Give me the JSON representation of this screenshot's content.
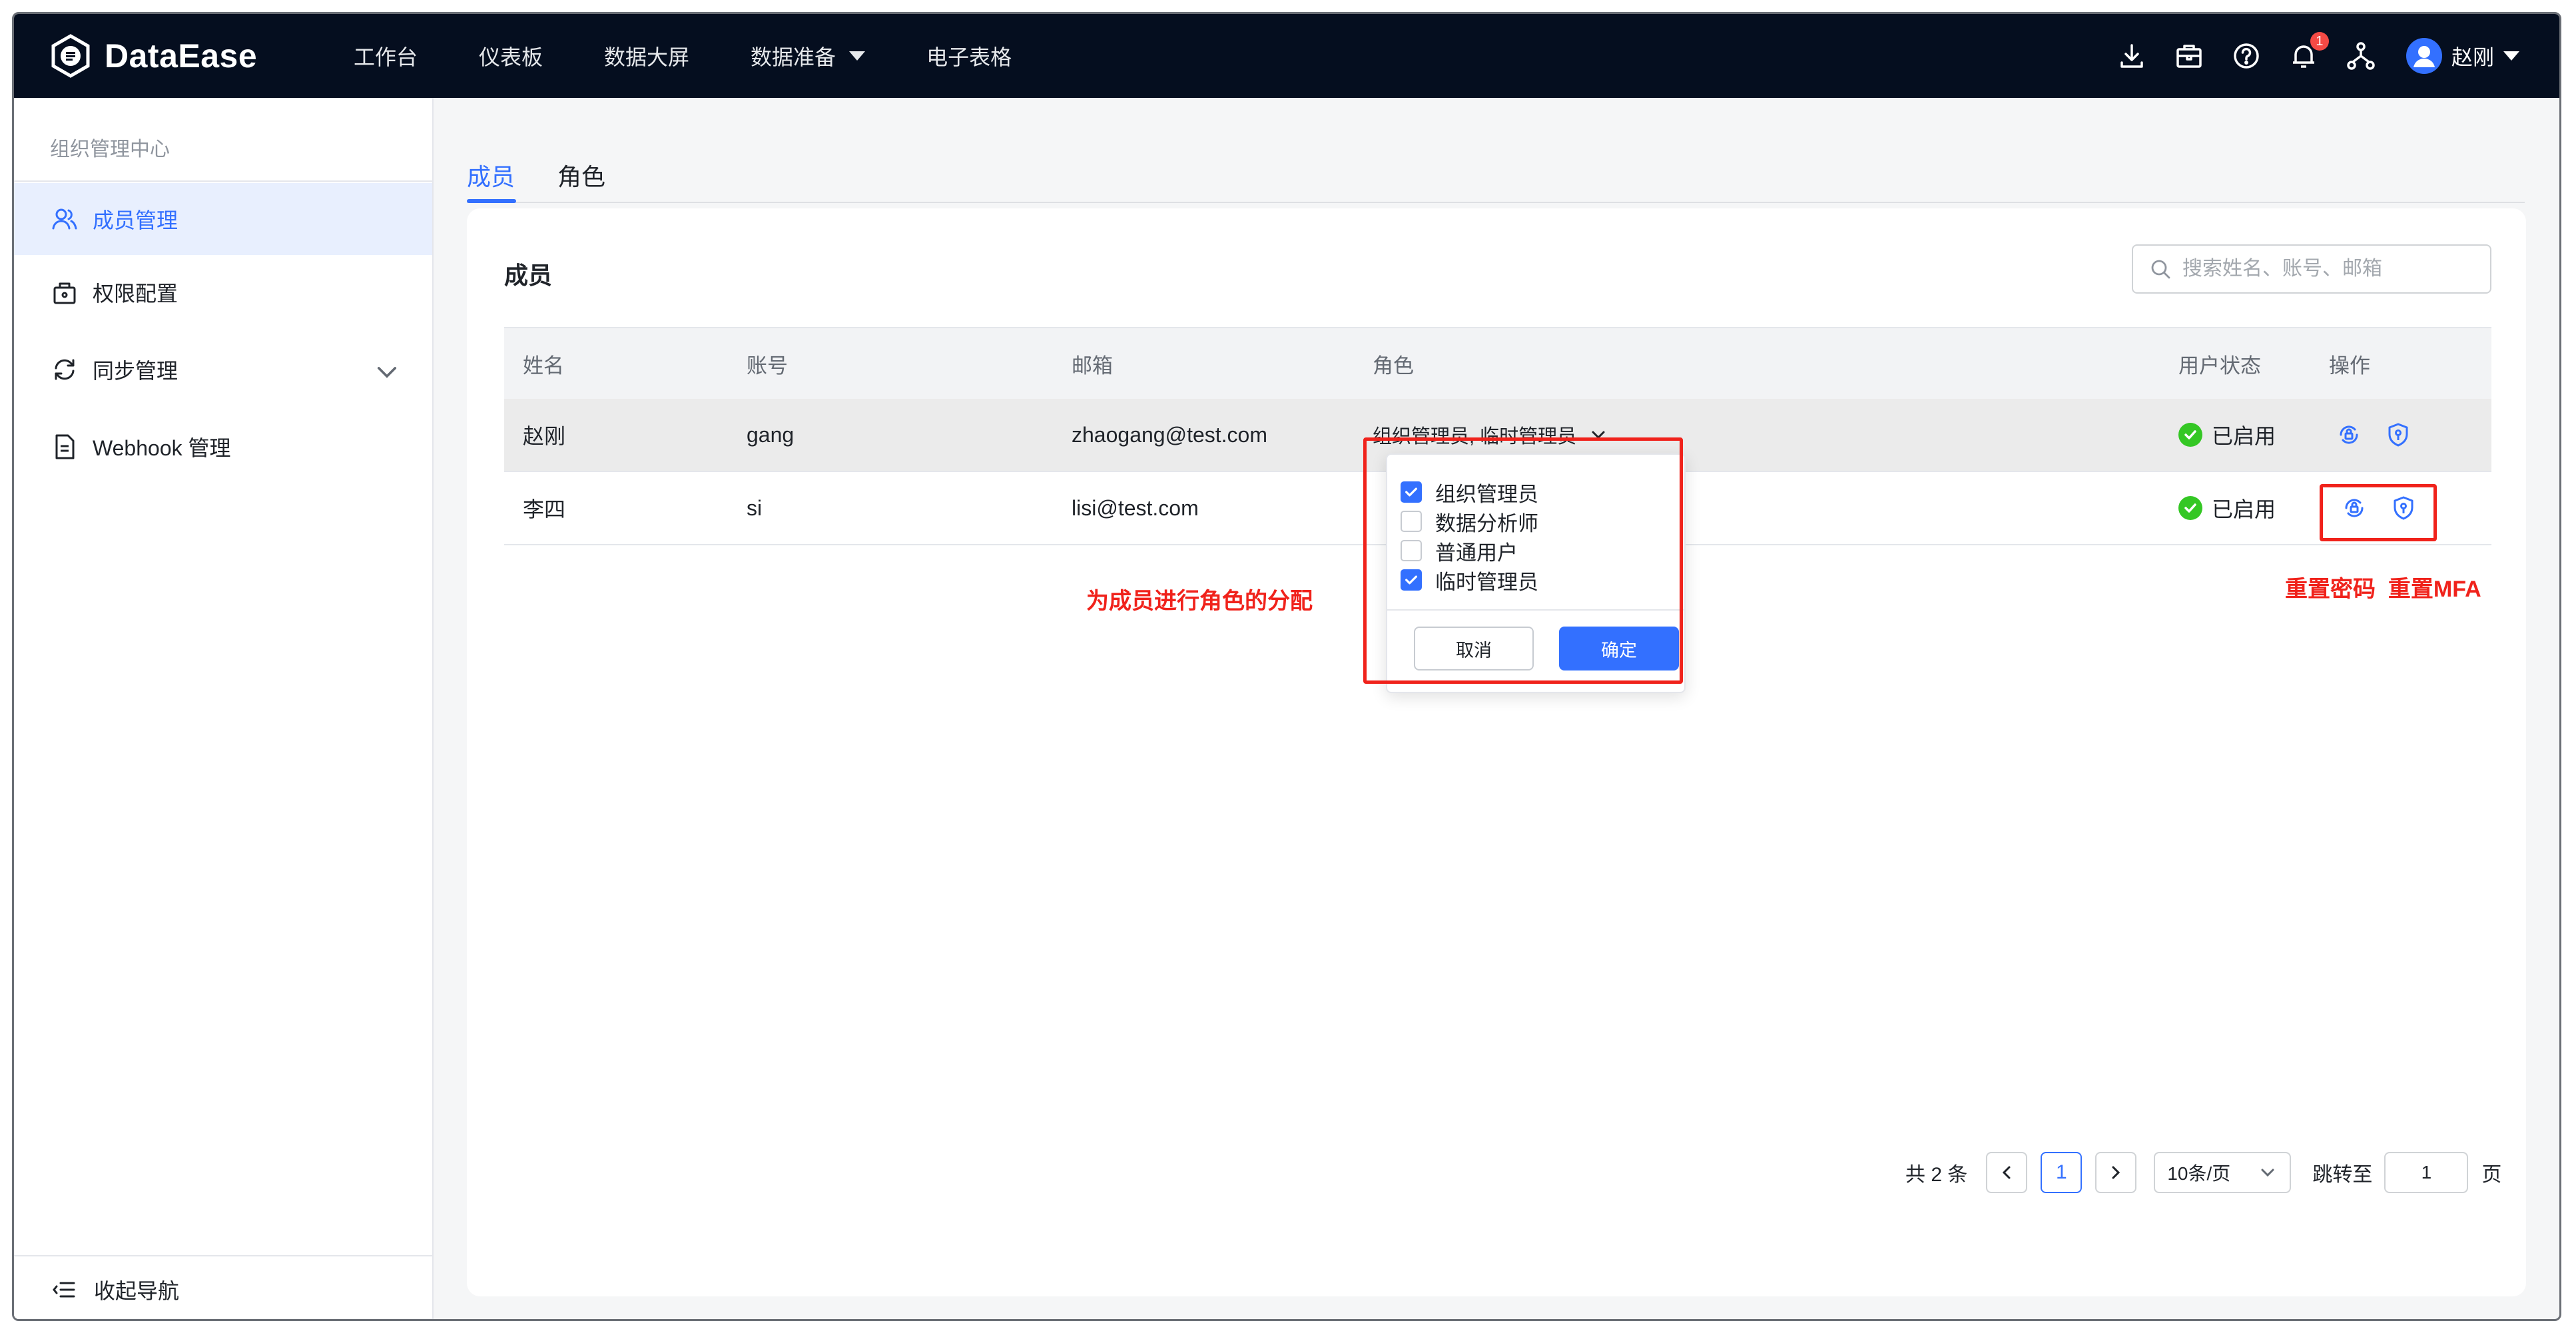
{
  "app": {
    "brand": "DataEase",
    "nav": [
      {
        "label": "工作台"
      },
      {
        "label": "仪表板"
      },
      {
        "label": "数据大屏"
      },
      {
        "label": "数据准备",
        "has_dropdown": true
      },
      {
        "label": "电子表格"
      }
    ],
    "notifications_count": "1",
    "user_name": "赵刚"
  },
  "sidebar": {
    "title": "组织管理中心",
    "items": [
      {
        "label": "成员管理",
        "icon": "members-icon",
        "active": true
      },
      {
        "label": "权限配置",
        "icon": "lock-icon"
      },
      {
        "label": "同步管理",
        "icon": "sync-icon",
        "expandable": true
      },
      {
        "label": "Webhook 管理",
        "icon": "document-icon"
      }
    ],
    "collapse_label": "收起导航"
  },
  "tabs": [
    {
      "label": "成员",
      "active": true
    },
    {
      "label": "角色"
    }
  ],
  "members": {
    "title": "成员",
    "search_placeholder": "搜索姓名、账号、邮箱",
    "columns": [
      "姓名",
      "账号",
      "邮箱",
      "角色",
      "用户状态",
      "操作"
    ],
    "rows": [
      {
        "name": "赵刚",
        "account": "gang",
        "email": "zhaogang@test.com",
        "roles": "组织管理员, 临时管理员",
        "status": "已启用"
      },
      {
        "name": "李四",
        "account": "si",
        "email": "lisi@test.com",
        "roles": "",
        "status": "已启用"
      }
    ]
  },
  "role_popover": {
    "options": [
      {
        "label": "组织管理员",
        "checked": true
      },
      {
        "label": "数据分析师",
        "checked": false
      },
      {
        "label": "普通用户",
        "checked": false
      },
      {
        "label": "临时管理员",
        "checked": true
      }
    ],
    "cancel_label": "取消",
    "confirm_label": "确定"
  },
  "annotations": {
    "assign_roles": "为成员进行角色的分配",
    "ops": "重置密码  重置MFA"
  },
  "pagination": {
    "total_text": "共 2 条",
    "current_page": "1",
    "page_size": "10条/页",
    "jump_label": "跳转至",
    "jump_value": "1",
    "page_suffix": "页"
  },
  "colors": {
    "topbar": "#050e1f",
    "primary": "#3370ff",
    "success": "#34c724",
    "annotation": "#f0221b"
  }
}
